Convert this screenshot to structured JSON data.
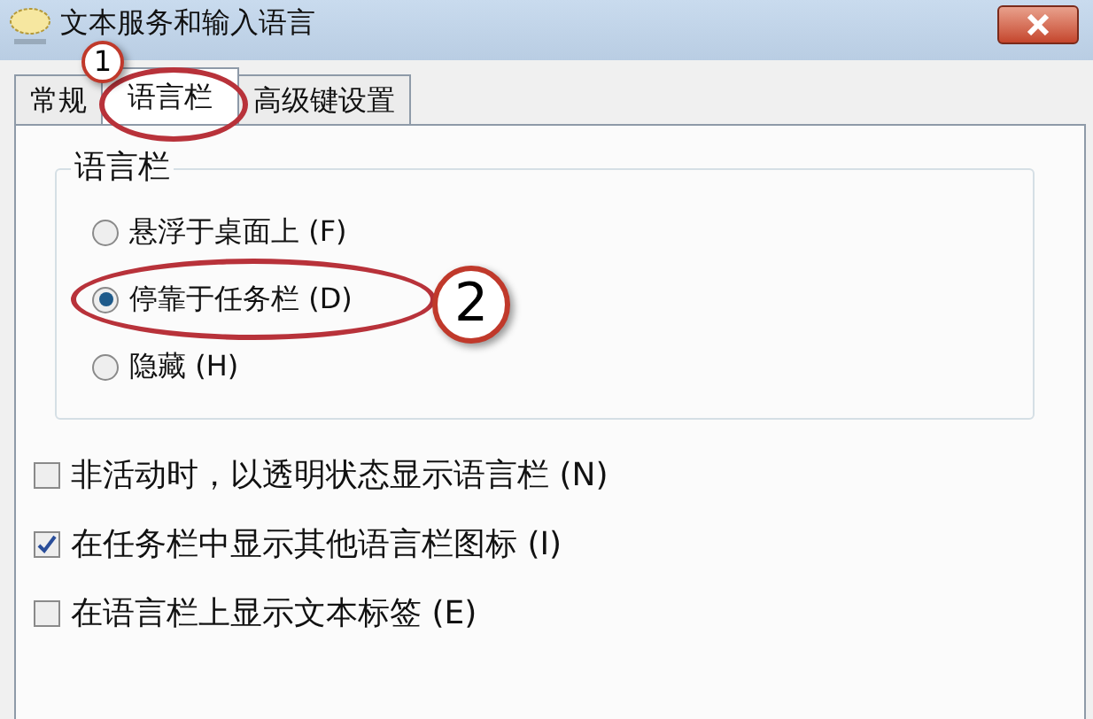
{
  "window": {
    "title": "文本服务和输入语言"
  },
  "tabs": [
    {
      "label": "常规",
      "selected": false
    },
    {
      "label": "语言栏",
      "selected": true
    },
    {
      "label": "高级键设置",
      "selected": false
    }
  ],
  "group": {
    "title": "语言栏",
    "options": [
      {
        "label": "悬浮于桌面上 (F)",
        "selected": false
      },
      {
        "label": "停靠于任务栏 (D)",
        "selected": true
      },
      {
        "label": "隐藏 (H)",
        "selected": false
      }
    ]
  },
  "checkboxes": [
    {
      "label": "非活动时，以透明状态显示语言栏 (N)",
      "checked": false
    },
    {
      "label": "在任务栏中显示其他语言栏图标 (I)",
      "checked": true
    },
    {
      "label": "在语言栏上显示文本标签 (E)",
      "checked": false
    }
  ],
  "annotations": [
    {
      "label": "1"
    },
    {
      "label": "2"
    }
  ]
}
